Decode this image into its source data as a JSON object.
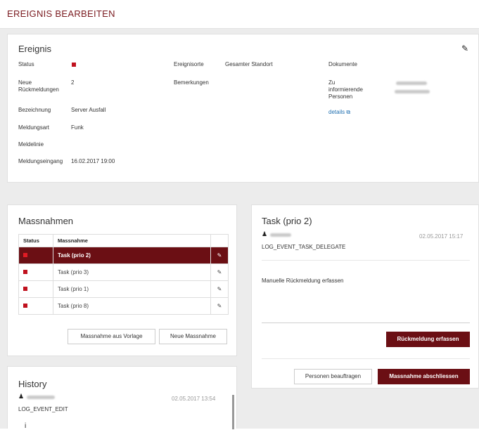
{
  "page": {
    "title": "EREIGNIS BEARBEITEN"
  },
  "ereignis": {
    "title": "Ereignis",
    "status_label": "Status",
    "neue_label": "Neue Rückmeldungen",
    "neue_value": "2",
    "bezeichnung_label": "Bezeichnung",
    "bezeichnung_value": "Server Ausfall",
    "meldungsart_label": "Meldungsart",
    "meldungsart_value": "Funk",
    "meldelinie_label": "Meldelinie",
    "meldungseingang_label": "Meldungseingang",
    "meldungseingang_value": "16.02.2017 19:00",
    "ereignisorte_label": "Ereignisorte",
    "ereignisorte_value": "Gesamter Standort",
    "bemerkungen_label": "Bemerkungen",
    "dokumente_label": "Dokumente",
    "zu_informierende_label": "Zu informierende Personen",
    "details_link": "details"
  },
  "massnahmen": {
    "title": "Massnahmen",
    "col_status": "Status",
    "col_massnahme": "Massnahme",
    "rows": [
      {
        "name": "Task (prio 2)",
        "selected": true
      },
      {
        "name": "Task (prio 3)",
        "selected": false
      },
      {
        "name": "Task (prio 1)",
        "selected": false
      },
      {
        "name": "Task (prio 8)",
        "selected": false
      }
    ],
    "btn_vorlage": "Massnahme aus Vorlage",
    "btn_neue": "Neue Massnahme"
  },
  "task": {
    "title": "Task (prio 2)",
    "timestamp": "02.05.2017 15:17",
    "event": "LOG_EVENT_TASK_DELEGATE",
    "manuelle": "Manuelle Rückmeldung erfassen",
    "btn_rueckmeldung": "Rückmeldung erfassen",
    "btn_personen": "Personen beauftragen",
    "btn_abschliessen": "Massnahme abschliessen"
  },
  "history": {
    "title": "History",
    "timestamp": "02.05.2017 13:54",
    "event": "LOG_EVENT_EDIT"
  },
  "colors": {
    "accent": "#6b0f14",
    "status_red": "#c0111e",
    "title_red": "#7a1a1f"
  }
}
